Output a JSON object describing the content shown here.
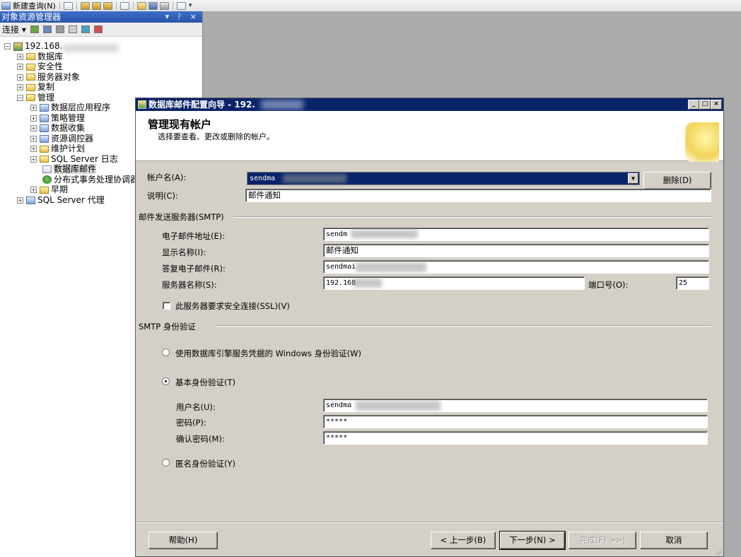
{
  "toolbar": {
    "new_query_label": "新建查询(N)"
  },
  "explorer": {
    "title": "对象资源管理器",
    "pin_controls": "▾ ᚹ ×",
    "connect_label": "连接",
    "server_node": "192.168.",
    "nodes": {
      "databases": "数据库",
      "security": "安全性",
      "server_objects": "服务器对象",
      "replication": "复制",
      "management": "管理",
      "data_tier": "数据层应用程序",
      "policy": "策略管理",
      "data_collection": "数据收集",
      "resource_governor": "资源调控器",
      "maintenance": "维护计划",
      "sql_log": "SQL Server 日志",
      "db_mail": "数据库邮件",
      "dtc": "分布式事务处理协调器",
      "legacy": "早期",
      "agent": "SQL Server 代理"
    }
  },
  "dialog": {
    "title": "数据库邮件配置向导 - 192.",
    "header_title": "管理现有帐户",
    "header_sub": "选择要查看、更改或删除的帐户。",
    "account_label": "帐户名(A):",
    "account_value": "sendma",
    "delete_button": "删除(D)",
    "desc_label": "说明(C):",
    "desc_value": "邮件通知",
    "smtp_group": "邮件发送服务器(SMTP)",
    "email_label": "电子邮件地址(E):",
    "email_value": "sendm",
    "display_label": "显示名称(I):",
    "display_value": "邮件通知",
    "reply_label": "答复电子邮件(R):",
    "reply_value": "sendmai",
    "server_label": "服务器名称(S):",
    "server_value": "192.168",
    "port_label": "端口号(O):",
    "port_value": "25",
    "ssl_label": "此服务器要求安全连接(SSL)(V)",
    "auth_group": "SMTP 身份验证",
    "win_auth_label": "使用数据库引擎服务凭据的 Windows 身份验证(W)",
    "basic_auth_label": "基本身份验证(T)",
    "user_label": "用户名(U):",
    "user_value": "sendma",
    "pwd_label": "密码(P):",
    "pwd_value": "*****",
    "confirm_label": "确认密码(M):",
    "confirm_value": "*****",
    "anon_label": "匿名身份验证(Y)",
    "help_button": "帮助(H)",
    "prev_button": "< 上一步(B)",
    "next_button": "下一步(N) >",
    "finish_button": "完成(F) >>|",
    "cancel_button": "取消",
    "selected_auth": "basic"
  }
}
